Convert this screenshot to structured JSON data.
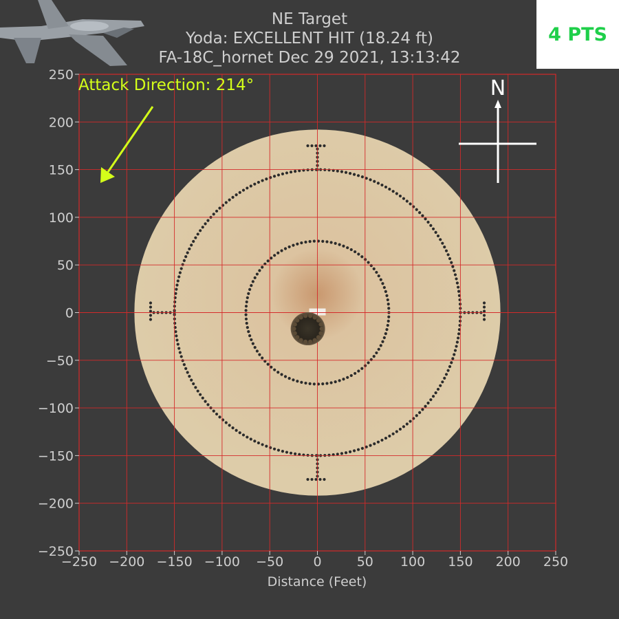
{
  "header": {
    "title_line1": "NE Target",
    "title_line2": "Yoda: EXCELLENT HIT (18.24 ft)",
    "title_line3": "FA-18C_hornet Dec 29 2021, 13:13:42"
  },
  "score": {
    "label": "4 PTS",
    "color": "#1fcf4a"
  },
  "aircraft_icon": "fa-18-jet-icon",
  "attack": {
    "label": "Attack Direction: 214°",
    "direction_deg": 214,
    "color": "#d4ff1a"
  },
  "compass": {
    "north_label": "N"
  },
  "colors": {
    "background": "#3b3b3b",
    "grid": "#d42a2a",
    "target_fill": "#d9c9a6",
    "dots": "#2b2b2b"
  },
  "chart_data": {
    "type": "scatter",
    "title": "NE Target",
    "xlabel": "Distance (Feet)",
    "ylabel": "",
    "xlim": [
      -250,
      250
    ],
    "ylim": [
      -250,
      250
    ],
    "xticks": [
      -250,
      -200,
      -150,
      -100,
      -50,
      0,
      50,
      100,
      150,
      200,
      250
    ],
    "yticks": [
      -250,
      -200,
      -150,
      -100,
      -50,
      0,
      50,
      100,
      150,
      200,
      250
    ],
    "grid": true,
    "rings_ft": [
      75,
      150
    ],
    "target_outer_radius_ft": 192,
    "impact": {
      "x": -10,
      "y": -17,
      "distance_ft": 18.24
    }
  }
}
